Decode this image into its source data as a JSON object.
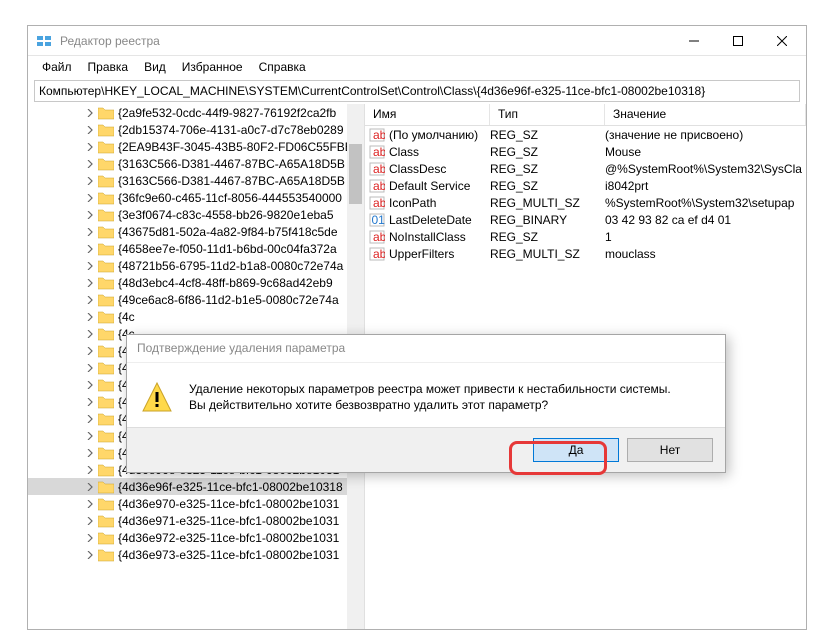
{
  "window": {
    "title": "Редактор реестра",
    "address_prefix": "Компьютер\\",
    "address": "HKEY_LOCAL_MACHINE\\SYSTEM\\CurrentControlSet\\Control\\Class\\{4d36e96f-e325-11ce-bfc1-08002be10318}"
  },
  "menu": {
    "file": "Файл",
    "edit": "Правка",
    "view": "Вид",
    "favorites": "Избранное",
    "help": "Справка"
  },
  "tree": {
    "items": [
      "{2a9fe532-0cdc-44f9-9827-76192f2ca2fb",
      "{2db15374-706e-4131-a0c7-d7c78eb0289",
      "{2EA9B43F-3045-43B5-80F2-FD06C55FBE",
      "{3163C566-D381-4467-87BC-A65A18D5B",
      "{3163C566-D381-4467-87BC-A65A18D5B",
      "{36fc9e60-c465-11cf-8056-444553540000",
      "{3e3f0674-c83c-4558-bb26-9820e1eba5",
      "{43675d81-502a-4a82-9f84-b75f418c5de",
      "{4658ee7e-f050-11d1-b6bd-00c04fa372a",
      "{48721b56-6795-11d2-b1a8-0080c72e74a",
      "{48d3ebc4-4cf8-48ff-b869-9c68ad42eb9",
      "{49ce6ac8-6f86-11d2-b1e5-0080c72e74a",
      "{4c",
      "{4c",
      "{4c",
      "{4c",
      "{4c",
      "{4c",
      "{4c",
      "{4d36e96c-e325-11ce-bfc1-08002be1031",
      "{4d36e96d-e325-11ce-bfc1-08002be1031",
      "{4d36e96e-e325-11ce-bfc1-08002be1031",
      "{4d36e96f-e325-11ce-bfc1-08002be10318",
      "{4d36e970-e325-11ce-bfc1-08002be1031",
      "{4d36e971-e325-11ce-bfc1-08002be1031",
      "{4d36e972-e325-11ce-bfc1-08002be1031",
      "{4d36e973-e325-11ce-bfc1-08002be1031"
    ],
    "selectedIndex": 22
  },
  "valuesHeader": {
    "name": "Имя",
    "type": "Тип",
    "value": "Значение"
  },
  "values": [
    {
      "icon": "sz",
      "name": "(По умолчанию)",
      "type": "REG_SZ",
      "value": "(значение не присвоено)"
    },
    {
      "icon": "sz",
      "name": "Class",
      "type": "REG_SZ",
      "value": "Mouse"
    },
    {
      "icon": "sz",
      "name": "ClassDesc",
      "type": "REG_SZ",
      "value": "@%SystemRoot%\\System32\\SysCla"
    },
    {
      "icon": "sz",
      "name": "Default Service",
      "type": "REG_SZ",
      "value": "i8042prt"
    },
    {
      "icon": "sz",
      "name": "IconPath",
      "type": "REG_MULTI_SZ",
      "value": "%SystemRoot%\\System32\\setupap"
    },
    {
      "icon": "bin",
      "name": "LastDeleteDate",
      "type": "REG_BINARY",
      "value": "03 42 93 82 ca ef d4 01"
    },
    {
      "icon": "sz",
      "name": "NoInstallClass",
      "type": "REG_SZ",
      "value": "1"
    },
    {
      "icon": "sz",
      "name": "UpperFilters",
      "type": "REG_MULTI_SZ",
      "value": "mouclass"
    }
  ],
  "dialog": {
    "title": "Подтверждение удаления параметра",
    "line1": "Удаление некоторых параметров реестра может привести к нестабильности системы.",
    "line2": "Вы действительно хотите безвозвратно удалить этот параметр?",
    "yes": "Да",
    "no": "Нет"
  }
}
